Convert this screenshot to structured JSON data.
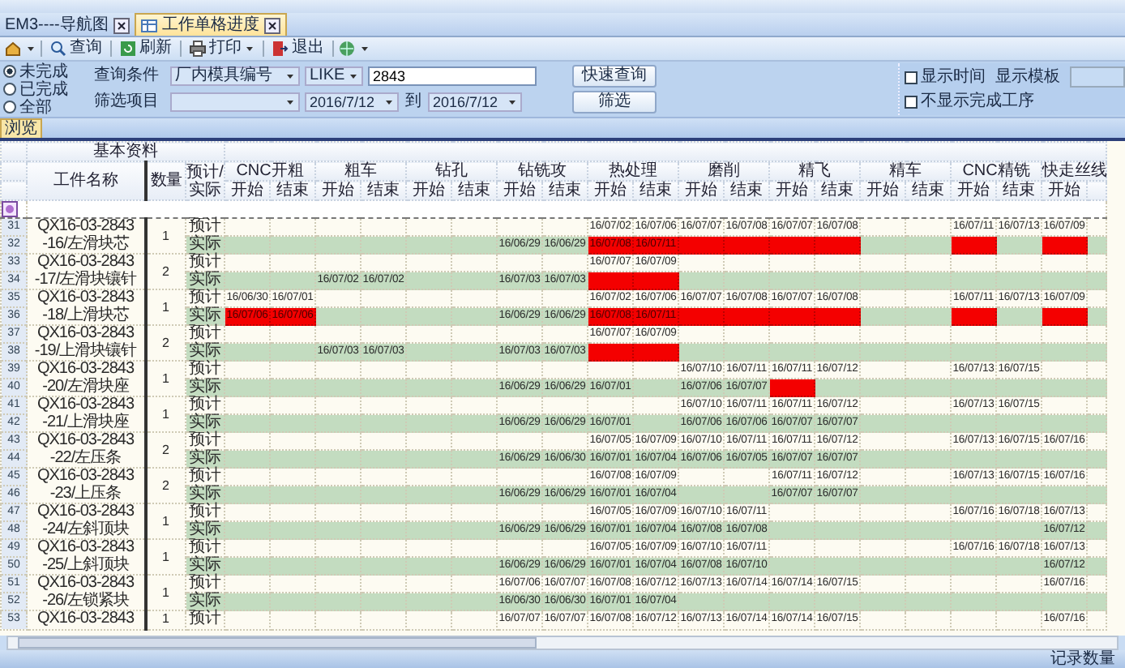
{
  "tabs": [
    {
      "label": "EM3----导航图",
      "selected": false
    },
    {
      "label": "工作单格进度",
      "selected": true
    }
  ],
  "toolbar": [
    {
      "label": "查询",
      "dropdown": false
    },
    {
      "label": "刷新",
      "dropdown": false
    },
    {
      "label": "打印",
      "dropdown": true
    },
    {
      "label": "退出",
      "dropdown": false
    }
  ],
  "filter": {
    "status_options": [
      {
        "label": "未完成",
        "selected": true
      },
      {
        "label": "已完成",
        "selected": false
      },
      {
        "label": "全部",
        "selected": false
      }
    ],
    "query_label": "查询条件",
    "query_field": "厂内模具编号",
    "operator": "LIKE",
    "query_value": "2843",
    "filter_label": "筛选项目",
    "date_from": "2016/7/12",
    "date_to_label": "到",
    "date_to": "2016/7/12",
    "buttons": [
      "快速查询",
      "筛选"
    ],
    "options": [
      {
        "label": "显示时间",
        "checked": false
      },
      {
        "label": "不显示完成工序",
        "checked": false
      }
    ],
    "template_label": "显示模板"
  },
  "view_tab": {
    "label": "浏览",
    "selected": true
  },
  "table": {
    "group_header": "基本资料",
    "name_header": "工件名称",
    "quantity_header": "数量",
    "type_header": "预计/实际",
    "stages": [
      {
        "name": "CNC开粗",
        "start": "开始",
        "end": "结束"
      },
      {
        "name": "粗车",
        "start": "开始",
        "end": "结束"
      },
      {
        "name": "钻孔",
        "start": "开始",
        "end": "结束"
      },
      {
        "name": "钻铣攻",
        "start": "开始",
        "end": "结束"
      },
      {
        "name": "热处理",
        "start": "开始",
        "end": "结束"
      },
      {
        "name": "磨削",
        "start": "开始",
        "end": "结束"
      },
      {
        "name": "精飞",
        "start": "开始",
        "end": "结束"
      },
      {
        "name": "精车",
        "start": "开始",
        "end": "结束"
      },
      {
        "name": "CNC精铣",
        "start": "开始",
        "end": "结束"
      },
      {
        "name": "快走丝线",
        "start": "开始"
      }
    ],
    "items": [
      {
        "numbers": [
          "31",
          "32"
        ],
        "name": "QX16-03-2843\n-16/左滑块芯",
        "quantity": "1",
        "rows": [
          {
            "label": "预计",
            "kind": "plan",
            "cells": [
              null,
              null,
              null,
              null,
              null,
              null,
              null,
              null,
              {
                "date": "16/07/02",
                "overdue": false
              },
              {
                "date": "16/07/06",
                "overdue": false
              },
              {
                "date": "16/07/07",
                "overdue": false
              },
              {
                "date": "16/07/08",
                "overdue": false
              },
              {
                "date": "16/07/07",
                "overdue": false
              },
              {
                "date": "16/07/08",
                "overdue": false
              },
              null,
              null,
              {
                "date": "16/07/11",
                "overdue": false
              },
              {
                "date": "16/07/13",
                "overdue": false
              },
              {
                "date": "16/07/09",
                "overdue": false
              }
            ]
          },
          {
            "label": "实际",
            "kind": "actual",
            "cells": [
              null,
              null,
              null,
              null,
              null,
              null,
              {
                "date": "16/06/29",
                "overdue": false
              },
              {
                "date": "16/06/29",
                "overdue": false
              },
              {
                "date": "16/07/08",
                "overdue": true
              },
              {
                "date": "16/07/11",
                "overdue": true
              },
              {
                "overdue": true
              },
              {
                "overdue": true
              },
              {
                "overdue": true
              },
              {
                "overdue": true
              },
              null,
              null,
              {
                "overdue": true
              },
              null,
              {
                "overdue": true
              }
            ]
          }
        ]
      },
      {
        "numbers": [
          "33",
          "34"
        ],
        "name": "QX16-03-2843\n-17/左滑块镶针",
        "quantity": "2",
        "rows": [
          {
            "label": "预计",
            "kind": "plan",
            "cells": [
              null,
              null,
              null,
              null,
              null,
              null,
              null,
              null,
              {
                "date": "16/07/07",
                "overdue": false
              },
              {
                "date": "16/07/09",
                "overdue": false
              },
              null,
              null,
              null,
              null,
              null,
              null,
              null,
              null,
              null
            ]
          },
          {
            "label": "实际",
            "kind": "actual",
            "cells": [
              null,
              null,
              {
                "date": "16/07/02",
                "overdue": false
              },
              {
                "date": "16/07/02",
                "overdue": false
              },
              null,
              null,
              {
                "date": "16/07/03",
                "overdue": false
              },
              {
                "date": "16/07/03",
                "overdue": false
              },
              {
                "overdue": true
              },
              {
                "overdue": true
              },
              null,
              null,
              null,
              null,
              null,
              null,
              null,
              null,
              null
            ]
          }
        ]
      },
      {
        "numbers": [
          "35",
          "36"
        ],
        "name": "QX16-03-2843\n-18/上滑块芯",
        "quantity": "1",
        "rows": [
          {
            "label": "预计",
            "kind": "plan",
            "cells": [
              {
                "date": "16/06/30",
                "overdue": false
              },
              {
                "date": "16/07/01",
                "overdue": false
              },
              null,
              null,
              null,
              null,
              null,
              null,
              {
                "date": "16/07/02",
                "overdue": false
              },
              {
                "date": "16/07/06",
                "overdue": false
              },
              {
                "date": "16/07/07",
                "overdue": false
              },
              {
                "date": "16/07/08",
                "overdue": false
              },
              {
                "date": "16/07/07",
                "overdue": false
              },
              {
                "date": "16/07/08",
                "overdue": false
              },
              null,
              null,
              {
                "date": "16/07/11",
                "overdue": false
              },
              {
                "date": "16/07/13",
                "overdue": false
              },
              {
                "date": "16/07/09",
                "overdue": false
              }
            ]
          },
          {
            "label": "实际",
            "kind": "actual",
            "cells": [
              {
                "date": "16/07/06",
                "overdue": true
              },
              {
                "date": "16/07/06",
                "overdue": true
              },
              null,
              null,
              null,
              null,
              {
                "date": "16/06/29",
                "overdue": false
              },
              {
                "date": "16/06/29",
                "overdue": false
              },
              {
                "date": "16/07/08",
                "overdue": true
              },
              {
                "date": "16/07/11",
                "overdue": true
              },
              {
                "overdue": true
              },
              {
                "overdue": true
              },
              {
                "overdue": true
              },
              {
                "overdue": true
              },
              null,
              null,
              {
                "overdue": true
              },
              null,
              {
                "overdue": true
              }
            ]
          }
        ]
      },
      {
        "numbers": [
          "37",
          "38"
        ],
        "name": "QX16-03-2843\n-19/上滑块镶针",
        "quantity": "2",
        "rows": [
          {
            "label": "预计",
            "kind": "plan",
            "cells": [
              null,
              null,
              null,
              null,
              null,
              null,
              null,
              null,
              {
                "date": "16/07/07",
                "overdue": false
              },
              {
                "date": "16/07/09",
                "overdue": false
              },
              null,
              null,
              null,
              null,
              null,
              null,
              null,
              null,
              null
            ]
          },
          {
            "label": "实际",
            "kind": "actual",
            "cells": [
              null,
              null,
              {
                "date": "16/07/03",
                "overdue": false
              },
              {
                "date": "16/07/03",
                "overdue": false
              },
              null,
              null,
              {
                "date": "16/07/03",
                "overdue": false
              },
              {
                "date": "16/07/03",
                "overdue": false
              },
              {
                "overdue": true
              },
              {
                "overdue": true
              },
              null,
              null,
              null,
              null,
              null,
              null,
              null,
              null,
              null
            ]
          }
        ]
      },
      {
        "numbers": [
          "39",
          "40"
        ],
        "name": "QX16-03-2843\n-20/左滑块座",
        "quantity": "1",
        "rows": [
          {
            "label": "预计",
            "kind": "plan",
            "cells": [
              null,
              null,
              null,
              null,
              null,
              null,
              null,
              null,
              null,
              null,
              {
                "date": "16/07/10",
                "overdue": false
              },
              {
                "date": "16/07/11",
                "overdue": false
              },
              {
                "date": "16/07/11",
                "overdue": false
              },
              {
                "date": "16/07/12",
                "overdue": false
              },
              null,
              null,
              {
                "date": "16/07/13",
                "overdue": false
              },
              {
                "date": "16/07/15",
                "overdue": false
              },
              null
            ]
          },
          {
            "label": "实际",
            "kind": "actual",
            "cells": [
              null,
              null,
              null,
              null,
              null,
              null,
              {
                "date": "16/06/29",
                "overdue": false
              },
              {
                "date": "16/06/29",
                "overdue": false
              },
              {
                "date": "16/07/01",
                "overdue": false
              },
              null,
              {
                "date": "16/07/06",
                "overdue": false
              },
              {
                "date": "16/07/07",
                "overdue": false
              },
              {
                "overdue": true
              },
              null,
              null,
              null,
              null,
              null,
              null
            ]
          }
        ]
      },
      {
        "numbers": [
          "41",
          "42"
        ],
        "name": "QX16-03-2843\n-21/上滑块座",
        "quantity": "1",
        "rows": [
          {
            "label": "预计",
            "kind": "plan",
            "cells": [
              null,
              null,
              null,
              null,
              null,
              null,
              null,
              null,
              null,
              null,
              {
                "date": "16/07/10",
                "overdue": false
              },
              {
                "date": "16/07/11",
                "overdue": false
              },
              {
                "date": "16/07/11",
                "overdue": false
              },
              {
                "date": "16/07/12",
                "overdue": false
              },
              null,
              null,
              {
                "date": "16/07/13",
                "overdue": false
              },
              {
                "date": "16/07/15",
                "overdue": false
              },
              null
            ]
          },
          {
            "label": "实际",
            "kind": "actual",
            "cells": [
              null,
              null,
              null,
              null,
              null,
              null,
              {
                "date": "16/06/29",
                "overdue": false
              },
              {
                "date": "16/06/29",
                "overdue": false
              },
              {
                "date": "16/07/01",
                "overdue": false
              },
              null,
              {
                "date": "16/07/06",
                "overdue": false
              },
              {
                "date": "16/07/06",
                "overdue": false
              },
              {
                "date": "16/07/07",
                "overdue": false
              },
              {
                "date": "16/07/07",
                "overdue": false
              },
              null,
              null,
              null,
              null,
              null
            ]
          }
        ]
      },
      {
        "numbers": [
          "43",
          "44"
        ],
        "name": "QX16-03-2843\n-22/左压条",
        "quantity": "2",
        "rows": [
          {
            "label": "预计",
            "kind": "plan",
            "cells": [
              null,
              null,
              null,
              null,
              null,
              null,
              null,
              null,
              {
                "date": "16/07/05",
                "overdue": false
              },
              {
                "date": "16/07/09",
                "overdue": false
              },
              {
                "date": "16/07/10",
                "overdue": false
              },
              {
                "date": "16/07/11",
                "overdue": false
              },
              {
                "date": "16/07/11",
                "overdue": false
              },
              {
                "date": "16/07/12",
                "overdue": false
              },
              null,
              null,
              {
                "date": "16/07/13",
                "overdue": false
              },
              {
                "date": "16/07/15",
                "overdue": false
              },
              {
                "date": "16/07/16",
                "overdue": false
              }
            ]
          },
          {
            "label": "实际",
            "kind": "actual",
            "cells": [
              null,
              null,
              null,
              null,
              null,
              null,
              {
                "date": "16/06/29",
                "overdue": false
              },
              {
                "date": "16/06/30",
                "overdue": false
              },
              {
                "date": "16/07/01",
                "overdue": false
              },
              {
                "date": "16/07/04",
                "overdue": false
              },
              {
                "date": "16/07/06",
                "overdue": false
              },
              {
                "date": "16/07/05",
                "overdue": false
              },
              {
                "date": "16/07/07",
                "overdue": false
              },
              {
                "date": "16/07/07",
                "overdue": false
              },
              null,
              null,
              null,
              null,
              null
            ]
          }
        ]
      },
      {
        "numbers": [
          "45",
          "46"
        ],
        "name": "QX16-03-2843\n-23/上压条",
        "quantity": "2",
        "rows": [
          {
            "label": "预计",
            "kind": "plan",
            "cells": [
              null,
              null,
              null,
              null,
              null,
              null,
              null,
              null,
              {
                "date": "16/07/08",
                "overdue": false
              },
              {
                "date": "16/07/09",
                "overdue": false
              },
              null,
              null,
              {
                "date": "16/07/11",
                "overdue": false
              },
              {
                "date": "16/07/12",
                "overdue": false
              },
              null,
              null,
              {
                "date": "16/07/13",
                "overdue": false
              },
              {
                "date": "16/07/15",
                "overdue": false
              },
              {
                "date": "16/07/16",
                "overdue": false
              }
            ]
          },
          {
            "label": "实际",
            "kind": "actual",
            "cells": [
              null,
              null,
              null,
              null,
              null,
              null,
              {
                "date": "16/06/29",
                "overdue": false
              },
              {
                "date": "16/06/29",
                "overdue": false
              },
              {
                "date": "16/07/01",
                "overdue": false
              },
              {
                "date": "16/07/04",
                "overdue": false
              },
              null,
              null,
              {
                "date": "16/07/07",
                "overdue": false
              },
              {
                "date": "16/07/07",
                "overdue": false
              },
              null,
              null,
              null,
              null,
              null
            ]
          }
        ]
      },
      {
        "numbers": [
          "47",
          "48"
        ],
        "name": "QX16-03-2843\n-24/左斜顶块",
        "quantity": "1",
        "rows": [
          {
            "label": "预计",
            "kind": "plan",
            "cells": [
              null,
              null,
              null,
              null,
              null,
              null,
              null,
              null,
              {
                "date": "16/07/05",
                "overdue": false
              },
              {
                "date": "16/07/09",
                "overdue": false
              },
              {
                "date": "16/07/10",
                "overdue": false
              },
              {
                "date": "16/07/11",
                "overdue": false
              },
              null,
              null,
              null,
              null,
              {
                "date": "16/07/16",
                "overdue": false
              },
              {
                "date": "16/07/18",
                "overdue": false
              },
              {
                "date": "16/07/13",
                "overdue": false
              }
            ]
          },
          {
            "label": "实际",
            "kind": "actual",
            "cells": [
              null,
              null,
              null,
              null,
              null,
              null,
              {
                "date": "16/06/29",
                "overdue": false
              },
              {
                "date": "16/06/29",
                "overdue": false
              },
              {
                "date": "16/07/01",
                "overdue": false
              },
              {
                "date": "16/07/04",
                "overdue": false
              },
              {
                "date": "16/07/08",
                "overdue": false
              },
              {
                "date": "16/07/08",
                "overdue": false
              },
              null,
              null,
              null,
              null,
              null,
              null,
              {
                "date": "16/07/12",
                "overdue": false
              }
            ]
          }
        ]
      },
      {
        "numbers": [
          "49",
          "50"
        ],
        "name": "QX16-03-2843\n-25/上斜顶块",
        "quantity": "1",
        "rows": [
          {
            "label": "预计",
            "kind": "plan",
            "cells": [
              null,
              null,
              null,
              null,
              null,
              null,
              null,
              null,
              {
                "date": "16/07/05",
                "overdue": false
              },
              {
                "date": "16/07/09",
                "overdue": false
              },
              {
                "date": "16/07/10",
                "overdue": false
              },
              {
                "date": "16/07/11",
                "overdue": false
              },
              null,
              null,
              null,
              null,
              {
                "date": "16/07/16",
                "overdue": false
              },
              {
                "date": "16/07/18",
                "overdue": false
              },
              {
                "date": "16/07/13",
                "overdue": false
              }
            ]
          },
          {
            "label": "实际",
            "kind": "actual",
            "cells": [
              null,
              null,
              null,
              null,
              null,
              null,
              {
                "date": "16/06/29",
                "overdue": false
              },
              {
                "date": "16/06/29",
                "overdue": false
              },
              {
                "date": "16/07/01",
                "overdue": false
              },
              {
                "date": "16/07/04",
                "overdue": false
              },
              {
                "date": "16/07/08",
                "overdue": false
              },
              {
                "date": "16/07/10",
                "overdue": false
              },
              null,
              null,
              null,
              null,
              null,
              null,
              {
                "date": "16/07/12",
                "overdue": false
              }
            ]
          }
        ]
      },
      {
        "numbers": [
          "51",
          "52"
        ],
        "name": "QX16-03-2843\n-26/左锁紧块",
        "quantity": "1",
        "rows": [
          {
            "label": "预计",
            "kind": "plan",
            "cells": [
              null,
              null,
              null,
              null,
              null,
              null,
              {
                "date": "16/07/06",
                "overdue": false
              },
              {
                "date": "16/07/07",
                "overdue": false
              },
              {
                "date": "16/07/08",
                "overdue": false
              },
              {
                "date": "16/07/12",
                "overdue": false
              },
              {
                "date": "16/07/13",
                "overdue": false
              },
              {
                "date": "16/07/14",
                "overdue": false
              },
              {
                "date": "16/07/14",
                "overdue": false
              },
              {
                "date": "16/07/15",
                "overdue": false
              },
              null,
              null,
              null,
              null,
              {
                "date": "16/07/16",
                "overdue": false
              }
            ]
          },
          {
            "label": "实际",
            "kind": "actual",
            "cells": [
              null,
              null,
              null,
              null,
              null,
              null,
              {
                "date": "16/06/30",
                "overdue": false
              },
              {
                "date": "16/06/30",
                "overdue": false
              },
              {
                "date": "16/07/01",
                "overdue": false
              },
              {
                "date": "16/07/04",
                "overdue": false
              },
              null,
              null,
              null,
              null,
              null,
              null,
              null,
              null,
              null
            ]
          }
        ]
      },
      {
        "numbers": [
          "53"
        ],
        "name": "QX16-03-2843",
        "quantity": "1",
        "rows": [
          {
            "label": "预计",
            "kind": "plan",
            "cells": [
              null,
              null,
              null,
              null,
              null,
              null,
              {
                "date": "16/07/07",
                "overdue": false
              },
              {
                "date": "16/07/07",
                "overdue": false
              },
              {
                "date": "16/07/08",
                "overdue": false
              },
              {
                "date": "16/07/12",
                "overdue": false
              },
              {
                "date": "16/07/13",
                "overdue": false
              },
              {
                "date": "16/07/14",
                "overdue": false
              },
              {
                "date": "16/07/14",
                "overdue": false
              },
              {
                "date": "16/07/15",
                "overdue": false
              },
              null,
              null,
              null,
              null,
              {
                "date": "16/07/16",
                "overdue": false
              }
            ]
          }
        ]
      }
    ]
  },
  "status_bar": {
    "record_label": "记录数量"
  }
}
